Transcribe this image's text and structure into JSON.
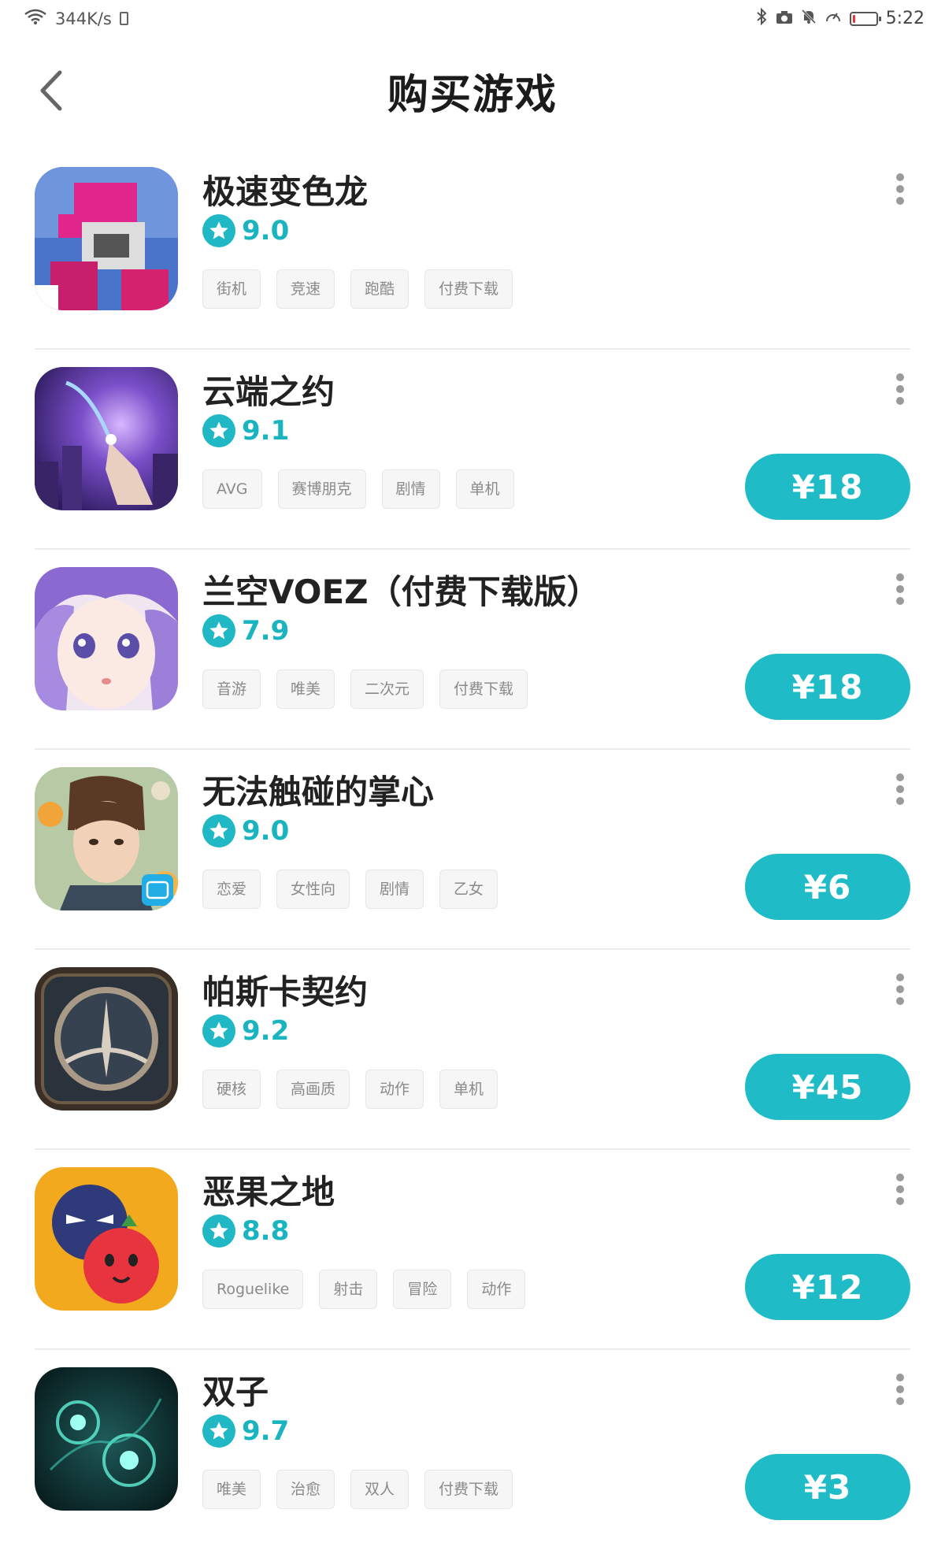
{
  "status_bar": {
    "network_speed": "344K/s",
    "time": "5:22",
    "icons": [
      "wifi-icon",
      "phone-icon",
      "bluetooth-icon",
      "camera-icon",
      "mute-bell-icon",
      "speedometer-icon",
      "battery-icon"
    ]
  },
  "header": {
    "title": "购买游戏",
    "back_icon": "chevron-left-icon"
  },
  "colors": {
    "accent": "#1fbcc7",
    "rating_text": "#19b4c0",
    "tag_bg": "#f6f6f6",
    "tag_text": "#8a8a8a"
  },
  "games": [
    {
      "name": "极速变色龙",
      "rating": "9.0",
      "tags": [
        "街机",
        "竞速",
        "跑酷",
        "付费下载"
      ],
      "price": "",
      "icon": "chameleon-run-icon"
    },
    {
      "name": "云端之约",
      "rating": "9.1",
      "tags": [
        "AVG",
        "赛博朋克",
        "剧情",
        "单机"
      ],
      "price": "¥18",
      "icon": "cloud-date-icon"
    },
    {
      "name": "兰空VOEZ（付费下载版）",
      "rating": "7.9",
      "tags": [
        "音游",
        "唯美",
        "二次元",
        "付费下载"
      ],
      "price": "¥18",
      "icon": "voez-icon"
    },
    {
      "name": "无法触碰的掌心",
      "rating": "9.0",
      "tags": [
        "恋爱",
        "女性向",
        "剧情",
        "乙女"
      ],
      "price": "¥6",
      "icon": "untouchable-palm-icon"
    },
    {
      "name": "帕斯卡契约",
      "rating": "9.2",
      "tags": [
        "硬核",
        "高画质",
        "动作",
        "单机"
      ],
      "price": "¥45",
      "icon": "pascal-contract-icon"
    },
    {
      "name": "恶果之地",
      "rating": "8.8",
      "tags": [
        "Roguelike",
        "射击",
        "冒险",
        "动作"
      ],
      "price": "¥12",
      "icon": "bad-fruit-icon"
    },
    {
      "name": "双子",
      "rating": "9.7",
      "tags": [
        "唯美",
        "治愈",
        "双人",
        "付费下载"
      ],
      "price": "¥3",
      "icon": "gemini-icon"
    }
  ]
}
